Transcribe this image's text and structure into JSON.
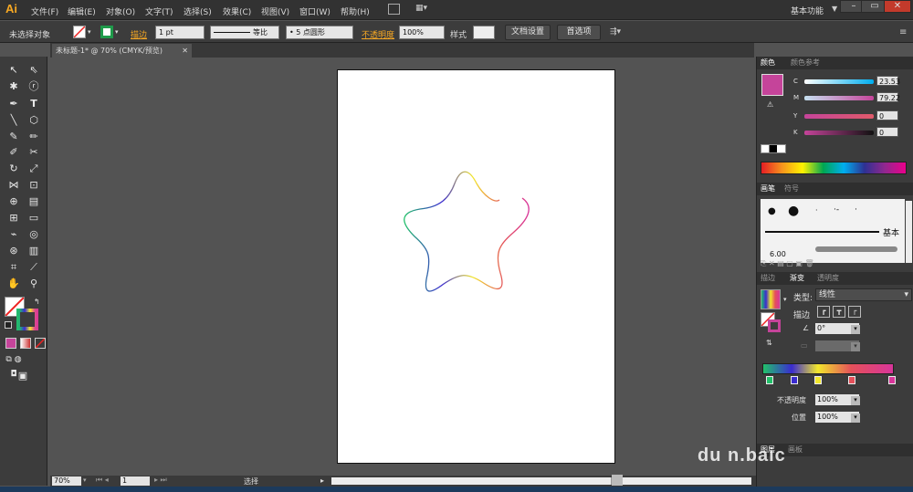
{
  "app": {
    "logo": "Ai"
  },
  "menu": [
    "文件(F)",
    "编辑(E)",
    "对象(O)",
    "文字(T)",
    "选择(S)",
    "效果(C)",
    "视图(V)",
    "窗口(W)",
    "帮助(H)"
  ],
  "workspace": "基本功能",
  "control_bar": {
    "selection_status": "未选择对象",
    "stroke_label": "描边",
    "stroke_weight": "1 pt",
    "stroke_profile": "等比",
    "brush": "5 点圆形",
    "opacity_label": "不透明度",
    "opacity_value": "100%",
    "style_label": "样式",
    "doc_setup": "文档设置",
    "preferences": "首选项"
  },
  "document": {
    "tab_title": "未标题-1* @ 70% (CMYK/预览)"
  },
  "status": {
    "zoom": "70%",
    "page": "1",
    "tool": "选择"
  },
  "color_panel": {
    "tabs": [
      "颜色",
      "颜色参考"
    ],
    "channels": [
      {
        "label": "C",
        "value": "23.53"
      },
      {
        "label": "M",
        "value": "79.22"
      },
      {
        "label": "Y",
        "value": "0"
      },
      {
        "label": "K",
        "value": "0"
      }
    ],
    "swatch_color": "#c5449a"
  },
  "brush_panel": {
    "tabs": [
      "画笔",
      "符号"
    ],
    "basic_label": "基本",
    "size": "6.00"
  },
  "gradient_panel": {
    "tabs": [
      "描边",
      "渐变",
      "透明度"
    ],
    "type_label": "类型:",
    "type_value": "线性",
    "stroke_label": "描边",
    "angle_value": "0°",
    "opacity_label": "不透明度",
    "opacity_value": "100%",
    "location_label": "位置",
    "location_value": "100%"
  },
  "bottom_tabs": [
    "图层",
    "画板"
  ],
  "watermark": "du n.baic",
  "colors": {
    "accent": "#f7a823",
    "gradient_stops": [
      "#22c16a",
      "#3a2bd0",
      "#f2e72c",
      "#e4505a",
      "#d8359a"
    ]
  }
}
